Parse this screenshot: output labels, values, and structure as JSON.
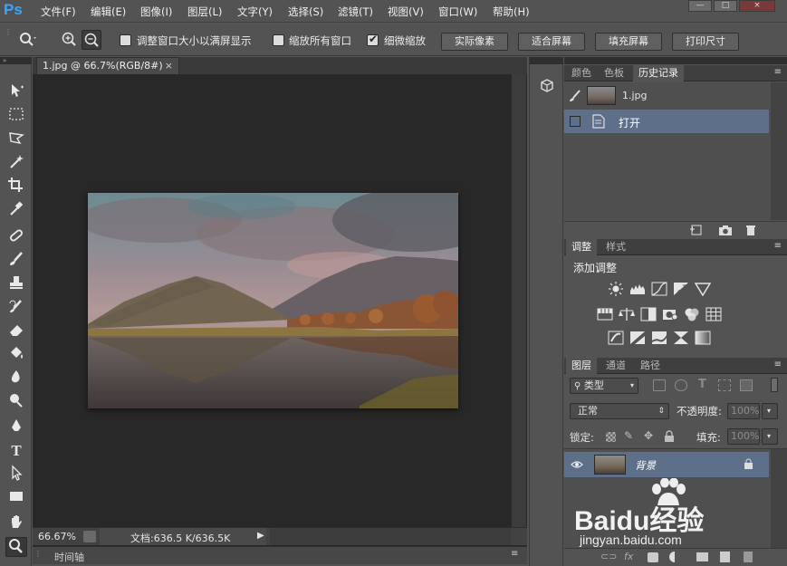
{
  "app": {
    "logo": "Ps"
  },
  "menu": [
    "文件(F)",
    "编辑(E)",
    "图像(I)",
    "图层(L)",
    "文字(Y)",
    "选择(S)",
    "滤镜(T)",
    "视图(V)",
    "窗口(W)",
    "帮助(H)"
  ],
  "window_controls": {
    "minimize": "—",
    "maximize": "□",
    "close": "×"
  },
  "options": {
    "resize_label": "调整窗口大小以满屏显示",
    "zoom_all_label": "缩放所有窗口",
    "scrubby_label": "细微缩放",
    "resize_checked": false,
    "zoom_all_checked": false,
    "scrubby_checked": true,
    "btn_actual": "实际像素",
    "btn_fit": "适合屏幕",
    "btn_fill": "填充屏幕",
    "btn_print": "打印尺寸"
  },
  "document": {
    "tab_title": "1.jpg @ 66.7%(RGB/8#)",
    "tab_close": "×",
    "zoom": "66.67%",
    "doc_info": "文档:636.5 K/636.5K",
    "status_arrow": "▶"
  },
  "timeline": {
    "label": "时间轴",
    "menu": "≡"
  },
  "history_panel": {
    "tabs": [
      "颜色",
      "色板",
      "历史记录"
    ],
    "active_tab": 2,
    "snapshot_name": "1.jpg",
    "states": [
      "打开"
    ]
  },
  "adjustments_panel": {
    "tabs": [
      "调整",
      "样式"
    ],
    "active_tab": 0,
    "heading": "添加调整"
  },
  "layers_panel": {
    "tabs": [
      "图层",
      "通道",
      "路径"
    ],
    "active_tab": 0,
    "filter_label": "类型",
    "blend_mode": "正常",
    "opacity_label": "不透明度:",
    "opacity_value": "100%",
    "lock_label": "锁定:",
    "fill_label": "填充:",
    "fill_value": "100%",
    "layer_name": "背景"
  },
  "watermark": {
    "brand": "Baidu经验",
    "url": "jingyan.baidu.com"
  },
  "colors": {
    "panel_bg": "#535353",
    "canvas_bg": "#282828",
    "selected_row": "#5a6a82",
    "ps_blue": "#31a8ff"
  }
}
